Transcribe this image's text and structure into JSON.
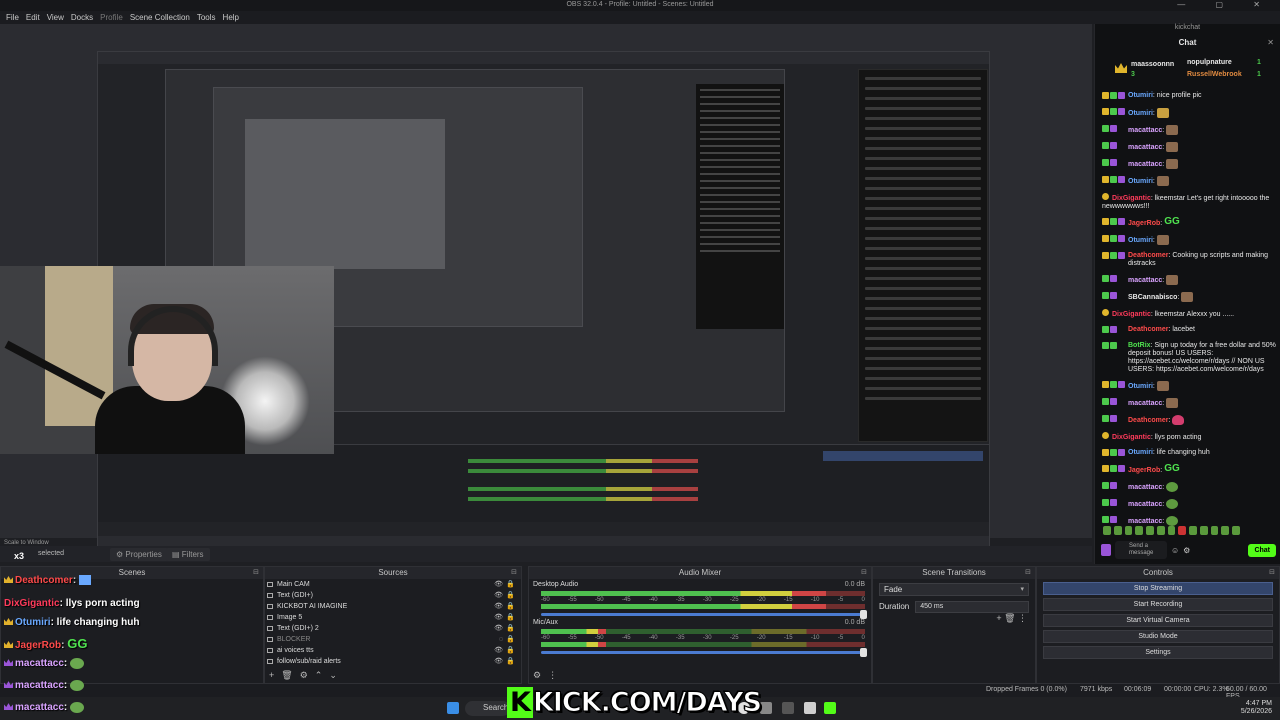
{
  "window": {
    "title": "OBS 32.0.4 - Profile: Untitled - Scenes: Untitled"
  },
  "menu": [
    "File",
    "Edit",
    "View",
    "Docks",
    "Profile",
    "Scene Collection",
    "Tools",
    "Help"
  ],
  "preview": {
    "scale_label": "Scale to Window",
    "selected_label": "selected"
  },
  "tabs": {
    "properties": "Properties",
    "filters": "Filters"
  },
  "scenes": {
    "header": "Scenes"
  },
  "sources": {
    "header": "Sources",
    "items": [
      "Main CAM",
      "Text (GDI+)",
      "KICKBOT AI IMAGINE",
      "Image 5",
      "Text (GDI+) 2",
      "BLOCKER",
      "ai voices tts",
      "follow/sub/raid alerts"
    ]
  },
  "mixer": {
    "header": "Audio Mixer",
    "tracks": [
      {
        "name": "Desktop Audio",
        "db": "0.0 dB",
        "level": 0.88
      },
      {
        "name": "Mic/Aux",
        "db": "0.0 dB",
        "level": 0.2
      }
    ],
    "scale": [
      "-60",
      "-55",
      "-50",
      "-45",
      "-40",
      "-35",
      "-30",
      "-25",
      "-20",
      "-15",
      "-10",
      "-5",
      "0"
    ]
  },
  "transitions": {
    "header": "Scene Transitions",
    "selected": "Fade",
    "duration_label": "Duration",
    "duration_value": "450 ms"
  },
  "controls": {
    "header": "Controls",
    "buttons": [
      "Stop Streaming",
      "Start Recording",
      "Start Virtual Camera",
      "Studio Mode",
      "Settings"
    ]
  },
  "status": {
    "dropped": "Dropped Frames 0 (0.0%)",
    "kbps": "7971 kbps",
    "time": "00:06:09",
    "time2": "00:00:00",
    "cpu": "CPU: 2.3%",
    "fps": "60.00 / 60.00 FPS"
  },
  "taskbar": {
    "search": "Search",
    "clock": "4:47 PM",
    "date": "5/26/2026"
  },
  "overlay": {
    "brand": "KICK.COM/DAYS",
    "multiplier": "x3",
    "lines": [
      {
        "user": "Deathcomer",
        "color": "#ff4b4b",
        "text": ""
      },
      {
        "user": "DixGigantic",
        "color": "#ff3b5b",
        "text": "llys porn acting"
      },
      {
        "user": "Otumiri",
        "color": "#6aa9ff",
        "text": "life changing huh"
      },
      {
        "user": "JagerRob",
        "color": "#ff4b4b",
        "text": "GG"
      },
      {
        "user": "macattacc",
        "color": "#d9a3ff",
        "text": ""
      },
      {
        "user": "macattacc",
        "color": "#d9a3ff",
        "text": ""
      },
      {
        "user": "macattacc",
        "color": "#d9a3ff",
        "text": ""
      }
    ]
  },
  "chat": {
    "window_title": "kickchat",
    "header": "Chat",
    "pinned": {
      "u1": "maassoonnn",
      "u2": "nopulpnature",
      "u3": "RussellWebrook",
      "n1": "3",
      "n2": "1",
      "n3": "1"
    },
    "messages": [
      {
        "user": "Otumiri",
        "color": "#6aa9ff",
        "text": "nice profile pic",
        "emote": ""
      },
      {
        "user": "Otumiri",
        "color": "#6aa9ff",
        "text": "",
        "emote": "img"
      },
      {
        "user": "macattacc",
        "color": "#d9a3ff",
        "text": "",
        "emote": "img"
      },
      {
        "user": "macattacc",
        "color": "#d9a3ff",
        "text": "",
        "emote": "img"
      },
      {
        "user": "macattacc",
        "color": "#d9a3ff",
        "text": "",
        "emote": "img"
      },
      {
        "user": "Otumiri",
        "color": "#6aa9ff",
        "text": "",
        "emote": "img"
      },
      {
        "user": "DixGigantic",
        "color": "#ff3b5b",
        "text": "lkeemstar Let's get right intooooo the newwwwwws!!!",
        "emote": ""
      },
      {
        "user": "JagerRob",
        "color": "#ff4b4b",
        "text": "",
        "emote": "GG"
      },
      {
        "user": "Otumiri",
        "color": "#6aa9ff",
        "text": "",
        "emote": "img"
      },
      {
        "user": "Deathcomer",
        "color": "#ff4b4b",
        "text": "Cooking up scripts and making distracks",
        "emote": ""
      },
      {
        "user": "macattacc",
        "color": "#d9a3ff",
        "text": "",
        "emote": "img"
      },
      {
        "user": "SBCannabisco",
        "color": "#e8e8e8",
        "text": "",
        "emote": "img"
      },
      {
        "user": "DixGigantic",
        "color": "#ff3b5b",
        "text": "lkeemstar Alexxx you ......",
        "emote": ""
      },
      {
        "user": "Deathcomer",
        "color": "#ff4b4b",
        "text": "lacebet",
        "emote": ""
      },
      {
        "user": "BotRix",
        "color": "#4fe24f",
        "text": "Sign up today for a free dollar and 50% deposit bonus! US USERS: https://acebet.cc/welcome/r/days // NON US USERS: https://acebet.com/welcome/r/days",
        "emote": ""
      },
      {
        "user": "Otumiri",
        "color": "#6aa9ff",
        "text": "",
        "emote": "img"
      },
      {
        "user": "macattacc",
        "color": "#d9a3ff",
        "text": "",
        "emote": "img"
      },
      {
        "user": "Deathcomer",
        "color": "#ff4b4b",
        "text": "",
        "emote": "heart"
      },
      {
        "user": "DixGigantic",
        "color": "#ff3b5b",
        "text": "llys porn acting",
        "emote": ""
      },
      {
        "user": "Otumiri",
        "color": "#6aa9ff",
        "text": "life changing huh",
        "emote": ""
      },
      {
        "user": "JagerRob",
        "color": "#ff4b4b",
        "text": "",
        "emote": "GG"
      },
      {
        "user": "macattacc",
        "color": "#d9a3ff",
        "text": "",
        "emote": "pepe"
      },
      {
        "user": "macattacc",
        "color": "#d9a3ff",
        "text": "",
        "emote": "pepe"
      },
      {
        "user": "macattacc",
        "color": "#d9a3ff",
        "text": "",
        "emote": "pepe"
      }
    ],
    "input_placeholder": "Send a message",
    "send_label": "Chat"
  }
}
